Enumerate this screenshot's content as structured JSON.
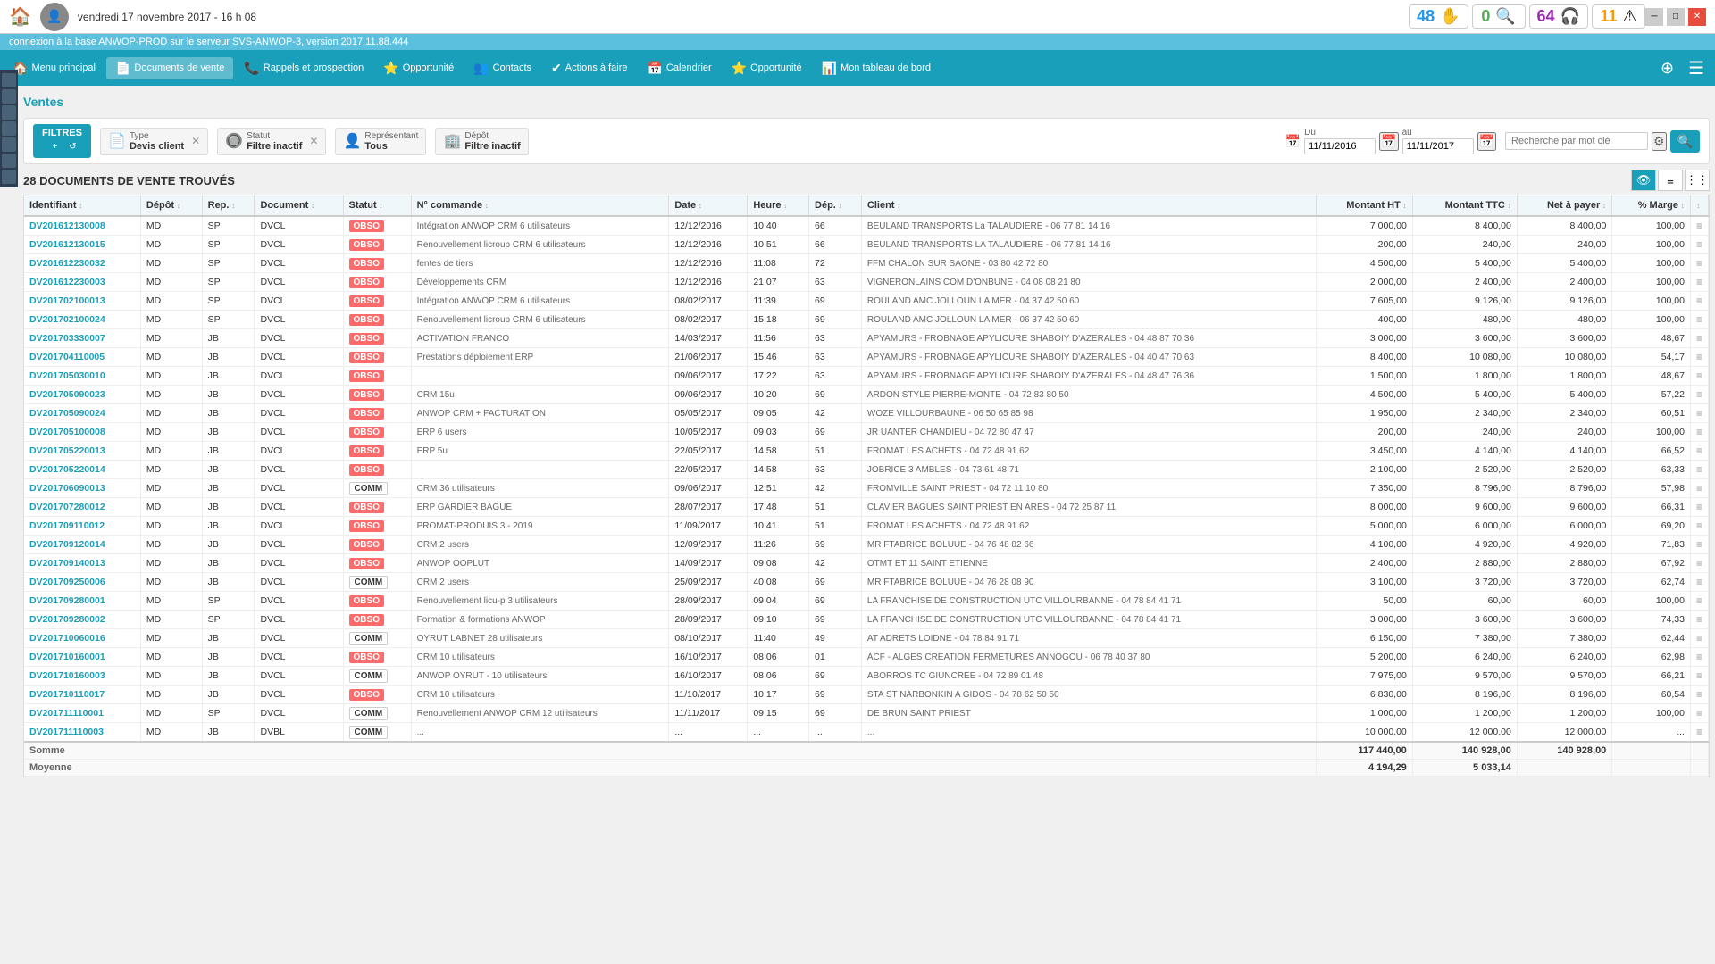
{
  "topbar": {
    "title": "vendredi 17 novembre 2017 - 16 h 08",
    "badges": [
      {
        "num": "48",
        "color": "blue",
        "icon": "✋"
      },
      {
        "num": "0",
        "color": "green",
        "icon": "🔍"
      },
      {
        "num": "64",
        "color": "purple",
        "icon": "🎧"
      },
      {
        "num": "11",
        "color": "orange",
        "icon": "⚠"
      }
    ]
  },
  "conn_bar": "connexion à la base ANWOP-PROD sur le serveur SVS-ANWOP-3, version 2017.11.88.444",
  "navbar": {
    "items": [
      {
        "id": "main",
        "icon": "🏠",
        "label": "Menu principal"
      },
      {
        "id": "ventes",
        "icon": "📄",
        "label": "Documents de vente"
      },
      {
        "id": "rappels",
        "icon": "📞",
        "label": "Rappels et prospection"
      },
      {
        "id": "opportunite1",
        "icon": "⭐",
        "label": "Opportunité"
      },
      {
        "id": "contacts",
        "icon": "👥",
        "label": "Contacts"
      },
      {
        "id": "actions",
        "icon": "✔",
        "label": "Actions à faire"
      },
      {
        "id": "calendrier",
        "icon": "📅",
        "label": "Calendrier"
      },
      {
        "id": "opportunite2",
        "icon": "⭐",
        "label": "Opportunité"
      },
      {
        "id": "tableau",
        "icon": "📊",
        "label": "Mon tableau de bord"
      }
    ]
  },
  "page_title": "Ventes",
  "filters": {
    "label": "FILTRES",
    "type": {
      "label": "Type",
      "value": "Devis client"
    },
    "statut": {
      "label": "Statut",
      "value": "Filtre inactif"
    },
    "representant": {
      "label": "Représentant",
      "value": "Tous"
    },
    "depot": {
      "label": "Dépôt",
      "value": "Filtre inactif"
    },
    "date_du": "11/11/2016",
    "date_au": "11/11/2017",
    "search_placeholder": "Recherche par mot clé"
  },
  "results": {
    "count_label": "28 DOCUMENTS DE VENTE TROUVÉS"
  },
  "columns": [
    "Identifiant",
    "Dépôt",
    "Rep.",
    "Document",
    "Statut",
    "N° commande",
    "Date",
    "Heure",
    "Dép.",
    "Client",
    "Montant HT",
    "Montant TTC",
    "Net à payer",
    "% Marge",
    ""
  ],
  "rows": [
    {
      "id": "DV201612130008",
      "depot": "MD",
      "rep": "SP",
      "doc": "DVCL",
      "statut": "OBSO",
      "commande": "Intégration ANWOP CRM 6 utilisateurs",
      "date": "12/12/2016",
      "heure": "10:40",
      "dep": "66",
      "client": "BEULAND TRANSPORTS La TALAUDIERE - 06 77 81 14 16",
      "ht": "7 000,00",
      "ttc": "8 400,00",
      "net": "8 400,00",
      "marge": "100,00"
    },
    {
      "id": "DV201612130015",
      "depot": "MD",
      "rep": "SP",
      "doc": "DVCL",
      "statut": "OBSO",
      "commande": "Renouvellement licroup CRM 6 utilisateurs",
      "date": "12/12/2016",
      "heure": "10:51",
      "dep": "66",
      "client": "BEULAND TRANSPORTS LA TALAUDIERE - 06 77 81 14 16",
      "ht": "200,00",
      "ttc": "240,00",
      "net": "240,00",
      "marge": "100,00"
    },
    {
      "id": "DV201612230032",
      "depot": "MD",
      "rep": "SP",
      "doc": "DVCL",
      "statut": "OBSO",
      "commande": "fentes de tiers",
      "date": "12/12/2016",
      "heure": "11:08",
      "dep": "72",
      "client": "FFM CHALON SUR SAONE - 03 80 42 72 80",
      "ht": "4 500,00",
      "ttc": "5 400,00",
      "net": "5 400,00",
      "marge": "100,00"
    },
    {
      "id": "DV201612230003",
      "depot": "MD",
      "rep": "SP",
      "doc": "DVCL",
      "statut": "OBSO",
      "commande": "Développements CRM",
      "date": "12/12/2016",
      "heure": "21:07",
      "dep": "63",
      "client": "VIGNERONLAINS COM D'ONBUNE - 04 08 08 21 80",
      "ht": "2 000,00",
      "ttc": "2 400,00",
      "net": "2 400,00",
      "marge": "100,00"
    },
    {
      "id": "DV201702100013",
      "depot": "MD",
      "rep": "SP",
      "doc": "DVCL",
      "statut": "OBSO",
      "commande": "Intégration ANWOP CRM 6 utilisateurs",
      "date": "08/02/2017",
      "heure": "11:39",
      "dep": "69",
      "client": "ROULAND AMC JOLLOUN LA MER - 04 37 42 50 60",
      "ht": "7 605,00",
      "ttc": "9 126,00",
      "net": "9 126,00",
      "marge": "100,00"
    },
    {
      "id": "DV201702100024",
      "depot": "MD",
      "rep": "SP",
      "doc": "DVCL",
      "statut": "OBSO",
      "commande": "Renouvellement licroup CRM 6 utilisateurs",
      "date": "08/02/2017",
      "heure": "15:18",
      "dep": "69",
      "client": "ROULAND AMC JOLLOUN LA MER - 06 37 42 50 60",
      "ht": "400,00",
      "ttc": "480,00",
      "net": "480,00",
      "marge": "100,00"
    },
    {
      "id": "DV201703330007",
      "depot": "MD",
      "rep": "JB",
      "doc": "DVCL",
      "statut": "OBSO",
      "commande": "ACTIVATION FRANCO",
      "date": "14/03/2017",
      "heure": "11:56",
      "dep": "63",
      "client": "APYAMURS - FROBNAGE APYLICURE SHABOIY D'AZERALES - 04 48 87 70 36",
      "ht": "3 000,00",
      "ttc": "3 600,00",
      "net": "3 600,00",
      "marge": "48,67"
    },
    {
      "id": "DV201704110005",
      "depot": "MD",
      "rep": "JB",
      "doc": "DVCL",
      "statut": "OBSO",
      "commande": "Prestations déploiement ERP",
      "date": "21/06/2017",
      "heure": "15:46",
      "dep": "63",
      "client": "APYAMURS - FROBNAGE APYLICURE SHABOIY D'AZERALES - 04 40 47 70 63",
      "ht": "8 400,00",
      "ttc": "10 080,00",
      "net": "10 080,00",
      "marge": "54,17"
    },
    {
      "id": "DV201705030010",
      "depot": "MD",
      "rep": "JB",
      "doc": "DVCL",
      "statut": "OBSO",
      "commande": "",
      "date": "09/06/2017",
      "heure": "17:22",
      "dep": "63",
      "client": "APYAMURS - FROBNAGE APYLICURE SHABOIY D'AZERALES - 04 48 47 76 36",
      "ht": "1 500,00",
      "ttc": "1 800,00",
      "net": "1 800,00",
      "marge": "48,67"
    },
    {
      "id": "DV201705090023",
      "depot": "MD",
      "rep": "JB",
      "doc": "DVCL",
      "statut": "OBSO",
      "commande": "CRM 15u",
      "date": "09/06/2017",
      "heure": "10:20",
      "dep": "69",
      "client": "ARDON STYLE PIERRE-MONTE - 04 72 83 80 50",
      "ht": "4 500,00",
      "ttc": "5 400,00",
      "net": "5 400,00",
      "marge": "57,22"
    },
    {
      "id": "DV201705090024",
      "depot": "MD",
      "rep": "JB",
      "doc": "DVCL",
      "statut": "OBSO",
      "commande": "ANWOP CRM + FACTURATION",
      "date": "05/05/2017",
      "heure": "09:05",
      "dep": "42",
      "client": "WOZE VILLOURBAUNE - 06 50 65 85 98",
      "ht": "1 950,00",
      "ttc": "2 340,00",
      "net": "2 340,00",
      "marge": "60,51"
    },
    {
      "id": "DV201705100008",
      "depot": "MD",
      "rep": "JB",
      "doc": "DVCL",
      "statut": "OBSO",
      "commande": "ERP 6 users",
      "date": "10/05/2017",
      "heure": "09:03",
      "dep": "69",
      "client": "JR UANTER CHANDIEU - 04 72 80 47 47",
      "ht": "200,00",
      "ttc": "240,00",
      "net": "240,00",
      "marge": "100,00"
    },
    {
      "id": "DV201705220013",
      "depot": "MD",
      "rep": "JB",
      "doc": "DVCL",
      "statut": "OBSO",
      "commande": "ERP 5u",
      "date": "22/05/2017",
      "heure": "14:58",
      "dep": "51",
      "client": "FROMAT LES ACHETS - 04 72 48 91 62",
      "ht": "3 450,00",
      "ttc": "4 140,00",
      "net": "4 140,00",
      "marge": "66,52"
    },
    {
      "id": "DV201705220014",
      "depot": "MD",
      "rep": "JB",
      "doc": "DVCL",
      "statut": "OBSO",
      "commande": "",
      "date": "22/05/2017",
      "heure": "14:58",
      "dep": "63",
      "client": "JOBRICE 3 AMBLES - 04 73 61 48 71",
      "ht": "2 100,00",
      "ttc": "2 520,00",
      "net": "2 520,00",
      "marge": "63,33"
    },
    {
      "id": "DV201706090013",
      "depot": "MD",
      "rep": "JB",
      "doc": "DVCL",
      "statut": "COMM",
      "commande": "CRM 36 utilisateurs",
      "date": "09/06/2017",
      "heure": "12:51",
      "dep": "42",
      "client": "FROMVILLE SAINT PRIEST - 04 72 11 10 80",
      "ht": "7 350,00",
      "ttc": "8 796,00",
      "net": "8 796,00",
      "marge": "57,98"
    },
    {
      "id": "DV201707280012",
      "depot": "MD",
      "rep": "JB",
      "doc": "DVCL",
      "statut": "OBSO",
      "commande": "ERP GARDIER BAGUE",
      "date": "28/07/2017",
      "heure": "17:48",
      "dep": "51",
      "client": "CLAVIER BAGUES SAINT PRIEST EN ARES - 04 72 25 87 11",
      "ht": "8 000,00",
      "ttc": "9 600,00",
      "net": "9 600,00",
      "marge": "66,31"
    },
    {
      "id": "DV201709110012",
      "depot": "MD",
      "rep": "JB",
      "doc": "DVCL",
      "statut": "OBSO",
      "commande": "PROMAT-PRODUIS 3 - 2019",
      "date": "11/09/2017",
      "heure": "10:41",
      "dep": "51",
      "client": "FROMAT LES ACHETS - 04 72 48 91 62",
      "ht": "5 000,00",
      "ttc": "6 000,00",
      "net": "6 000,00",
      "marge": "69,20"
    },
    {
      "id": "DV201709120014",
      "depot": "MD",
      "rep": "JB",
      "doc": "DVCL",
      "statut": "OBSO",
      "commande": "CRM 2 users",
      "date": "12/09/2017",
      "heure": "11:26",
      "dep": "69",
      "client": "MR FTABRICE BOLUUE - 04 76 48 82 66",
      "ht": "4 100,00",
      "ttc": "4 920,00",
      "net": "4 920,00",
      "marge": "71,83"
    },
    {
      "id": "DV201709140013",
      "depot": "MD",
      "rep": "JB",
      "doc": "DVCL",
      "statut": "OBSO",
      "commande": "ANWOP OOPLUT",
      "date": "14/09/2017",
      "heure": "09:08",
      "dep": "42",
      "client": "OTMT ET 11 SAINT ETIENNE",
      "ht": "2 400,00",
      "ttc": "2 880,00",
      "net": "2 880,00",
      "marge": "67,92"
    },
    {
      "id": "DV201709250006",
      "depot": "MD",
      "rep": "JB",
      "doc": "DVCL",
      "statut": "COMM",
      "commande": "CRM 2 users",
      "date": "25/09/2017",
      "heure": "40:08",
      "dep": "69",
      "client": "MR FTABRICE BOLUUE - 04 76 28 08 90",
      "ht": "3 100,00",
      "ttc": "3 720,00",
      "net": "3 720,00",
      "marge": "62,74"
    },
    {
      "id": "DV201709280001",
      "depot": "MD",
      "rep": "SP",
      "doc": "DVCL",
      "statut": "OBSO",
      "commande": "Renouvellement licu-p 3 utilisateurs",
      "date": "28/09/2017",
      "heure": "09:04",
      "dep": "69",
      "client": "LA FRANCHISE DE CONSTRUCTION UTC VILLOURBANNE - 04 78 84 41 71",
      "ht": "50,00",
      "ttc": "60,00",
      "net": "60,00",
      "marge": "100,00"
    },
    {
      "id": "DV201709280002",
      "depot": "MD",
      "rep": "SP",
      "doc": "DVCL",
      "statut": "OBSO",
      "commande": "Formation & formations ANWOP",
      "date": "28/09/2017",
      "heure": "09:10",
      "dep": "69",
      "client": "LA FRANCHISE DE CONSTRUCTION UTC VILLOURBANNE - 04 78 84 41 71",
      "ht": "3 000,00",
      "ttc": "3 600,00",
      "net": "3 600,00",
      "marge": "74,33"
    },
    {
      "id": "DV201710060016",
      "depot": "MD",
      "rep": "JB",
      "doc": "DVCL",
      "statut": "COMM",
      "commande": "OYRUT LABNET 28 utilisateurs",
      "date": "08/10/2017",
      "heure": "11:40",
      "dep": "49",
      "client": "AT ADRETS LOIDNE - 04 78 84 91 71",
      "ht": "6 150,00",
      "ttc": "7 380,00",
      "net": "7 380,00",
      "marge": "62,44"
    },
    {
      "id": "DV201710160001",
      "depot": "MD",
      "rep": "JB",
      "doc": "DVCL",
      "statut": "OBSO",
      "commande": "CRM 10 utilisateurs",
      "date": "16/10/2017",
      "heure": "08:06",
      "dep": "01",
      "client": "ACF - ALGES CREATION FERMETURES ANNOGOU - 06 78 40 37 80",
      "ht": "5 200,00",
      "ttc": "6 240,00",
      "net": "6 240,00",
      "marge": "62,98"
    },
    {
      "id": "DV201710160003",
      "depot": "MD",
      "rep": "JB",
      "doc": "DVCL",
      "statut": "COMM",
      "commande": "ANWOP OYRUT - 10 utilisateurs",
      "date": "16/10/2017",
      "heure": "08:06",
      "dep": "69",
      "client": "ABORROS TC GIUNCREE - 04 72 89 01 48",
      "ht": "7 975,00",
      "ttc": "9 570,00",
      "net": "9 570,00",
      "marge": "66,21"
    },
    {
      "id": "DV201710110017",
      "depot": "MD",
      "rep": "JB",
      "doc": "DVCL",
      "statut": "OBSO",
      "commande": "CRM 10 utilisateurs",
      "date": "11/10/2017",
      "heure": "10:17",
      "dep": "69",
      "client": "STA ST NARBONKIN A GIDOS - 04 78 62 50 50",
      "ht": "6 830,00",
      "ttc": "8 196,00",
      "net": "8 196,00",
      "marge": "60,54"
    },
    {
      "id": "DV201711110001",
      "depot": "MD",
      "rep": "SP",
      "doc": "DVCL",
      "statut": "COMM",
      "commande": "Renouvellement ANWOP CRM 12 utilisateurs",
      "date": "11/11/2017",
      "heure": "09:15",
      "dep": "69",
      "client": "DE BRUN SAINT PRIEST",
      "ht": "1 000,00",
      "ttc": "1 200,00",
      "net": "1 200,00",
      "marge": "100,00"
    },
    {
      "id": "DV201711110003",
      "depot": "MD",
      "rep": "JB",
      "doc": "DVBL",
      "statut": "COMM",
      "commande": "...",
      "date": "...",
      "heure": "...",
      "dep": "...",
      "client": "...",
      "ht": "10 000,00",
      "ttc": "12 000,00",
      "net": "12 000,00",
      "marge": "..."
    }
  ],
  "footer": {
    "sum_label": "Somme",
    "avg_label": "Moyenne",
    "sum_ht": "117 440,00",
    "sum_ttc": "140 928,00",
    "sum_net": "140 928,00",
    "avg_ht": "4 194,29",
    "avg_ttc": "5 033,14",
    "avg_net": ""
  }
}
